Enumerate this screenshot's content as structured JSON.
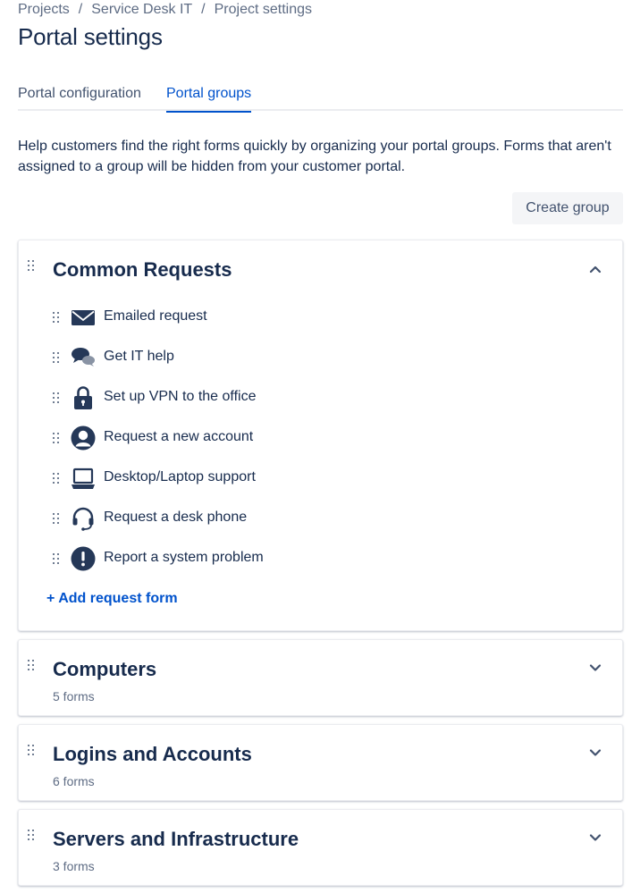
{
  "breadcrumb": {
    "items": [
      "Projects",
      "Service Desk IT",
      "Project settings"
    ],
    "separator": "/"
  },
  "page_title": "Portal settings",
  "tabs": [
    {
      "label": "Portal configuration",
      "active": false
    },
    {
      "label": "Portal groups",
      "active": true
    }
  ],
  "description": "Help customers find the right forms quickly by organizing your portal groups. Forms that aren't assigned to a group will be hidden from your customer portal.",
  "create_group_label": "Create group",
  "groups": [
    {
      "title": "Common Requests",
      "expanded": true,
      "items": [
        {
          "label": "Emailed request",
          "icon": "envelope-icon"
        },
        {
          "label": "Get IT help",
          "icon": "chat-bubbles-icon"
        },
        {
          "label": "Set up VPN to the office",
          "icon": "padlock-icon"
        },
        {
          "label": "Request a new account",
          "icon": "person-icon"
        },
        {
          "label": "Desktop/Laptop support",
          "icon": "laptop-icon"
        },
        {
          "label": "Request a desk phone",
          "icon": "headset-icon"
        },
        {
          "label": "Report a system problem",
          "icon": "exclamation-icon"
        }
      ],
      "add_label": "+ Add request form"
    },
    {
      "title": "Computers",
      "expanded": false,
      "count": "5 forms"
    },
    {
      "title": "Logins and Accounts",
      "expanded": false,
      "count": "6 forms"
    },
    {
      "title": "Servers and Infrastructure",
      "expanded": false,
      "count": "3 forms"
    }
  ],
  "colors": {
    "text": "#172B4D",
    "subtle": "#5E6C84",
    "link": "#0052CC",
    "icon": "#253858"
  }
}
